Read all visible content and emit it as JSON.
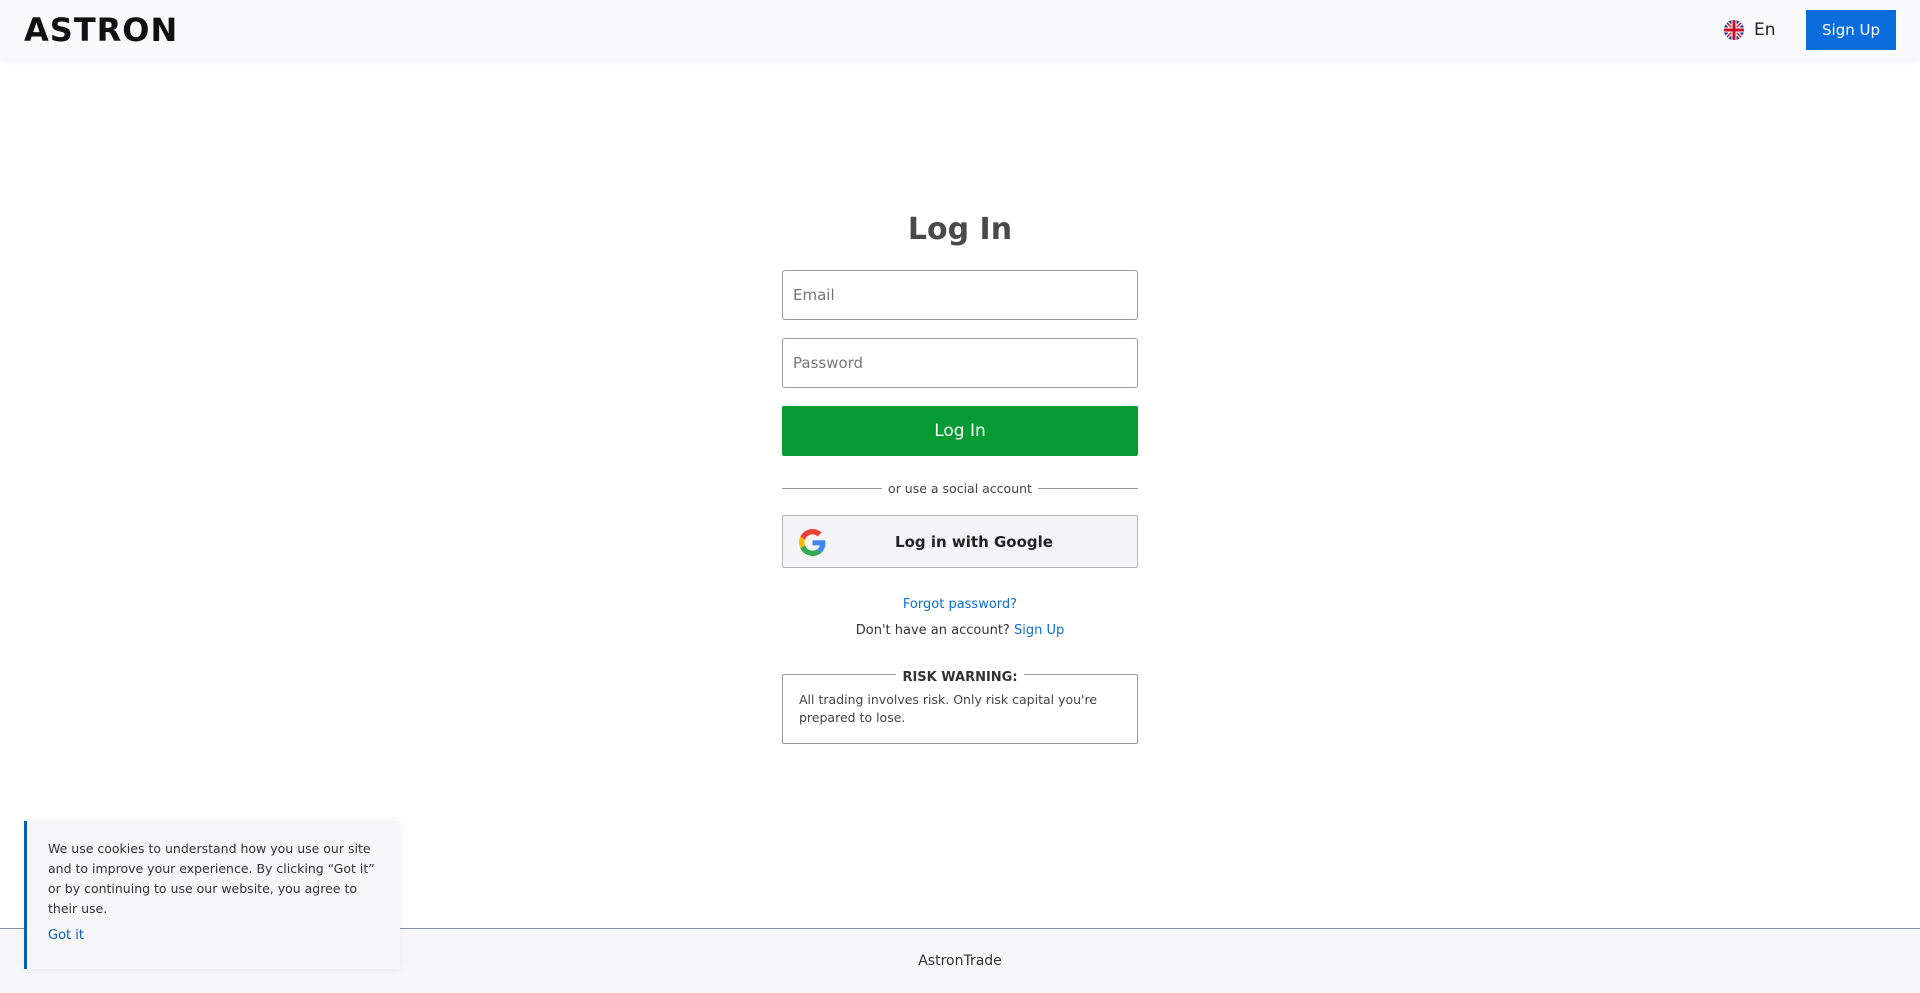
{
  "header": {
    "logo": "ASTRON",
    "language": "En",
    "signup_label": "Sign Up"
  },
  "login": {
    "title": "Log In",
    "email_placeholder": "Email",
    "password_placeholder": "Password",
    "login_label": "Log In",
    "divider_text": "or use a social account",
    "google_label": "Log in with Google",
    "forgot_label": "Forgot password?",
    "no_account_text": "Don't have an account?",
    "signup_link": "Sign Up"
  },
  "risk": {
    "title": "RISK WARNING:",
    "text": "All trading involves risk. Only risk capital you're prepared to lose."
  },
  "cookie": {
    "text": "We use cookies to understand how you use our site and to improve your experience. By clicking “Got it” or by continuing to use our website, you agree to their use.",
    "button": "Got it"
  },
  "footer": {
    "text": "AstronTrade"
  },
  "colors": {
    "primary_blue": "#0a6ddb",
    "login_green": "#069b33"
  }
}
